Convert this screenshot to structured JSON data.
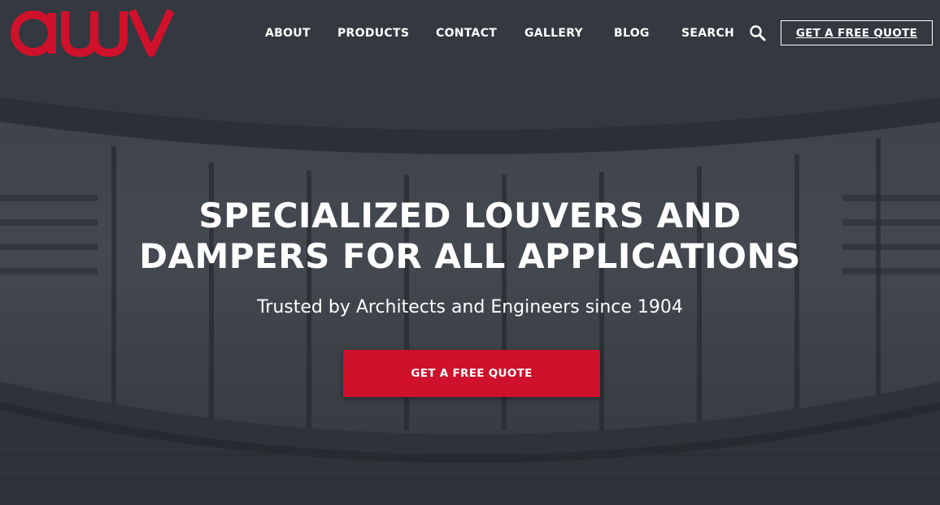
{
  "brand": {
    "logo_text": "awv",
    "color": "#d0112b"
  },
  "nav": {
    "items": [
      {
        "label": "ABOUT"
      },
      {
        "label": "PRODUCTS"
      },
      {
        "label": "CONTACT"
      },
      {
        "label": "GALLERY"
      },
      {
        "label": "BLOG"
      },
      {
        "label": "SEARCH"
      }
    ],
    "search_icon": "magnifier-icon",
    "quote_button_label": "GET A FREE QUOTE"
  },
  "hero": {
    "headline_line1": "SPECIALIZED LOUVERS AND",
    "headline_line2": "DAMPERS FOR ALL APPLICATIONS",
    "subtitle": "Trusted by Architects and Engineers since 1904",
    "cta_label": "GET A FREE QUOTE",
    "cta_color": "#d0112b"
  }
}
